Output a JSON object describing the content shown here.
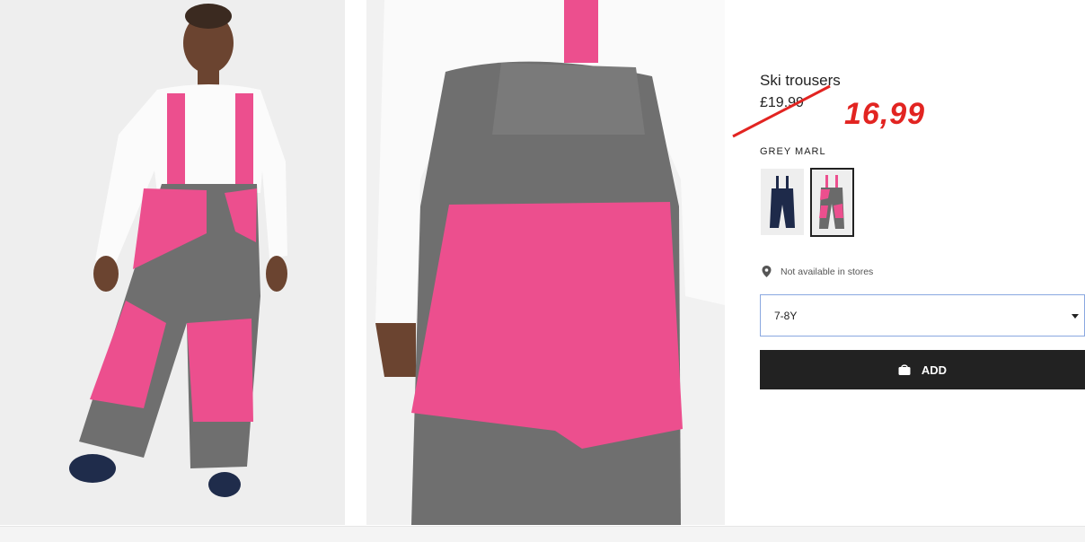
{
  "product": {
    "title": "Ski trousers",
    "old_price": "£19.99",
    "sale_price": "16,99",
    "color_label": "GREY MARL",
    "availability": "Not available in stores",
    "selected_size": "7-8Y",
    "add_label": "ADD"
  },
  "swatches": [
    {
      "name": "navy",
      "color": "#1e2a4a"
    },
    {
      "name": "grey-marl",
      "color": "#6a6a6a",
      "accent": "#ec4f8e"
    }
  ],
  "colors": {
    "accent_pink": "#ec4f8e",
    "grey_fabric": "#6b6b6b",
    "sale_red": "#e22421",
    "button_bg": "#222222"
  }
}
